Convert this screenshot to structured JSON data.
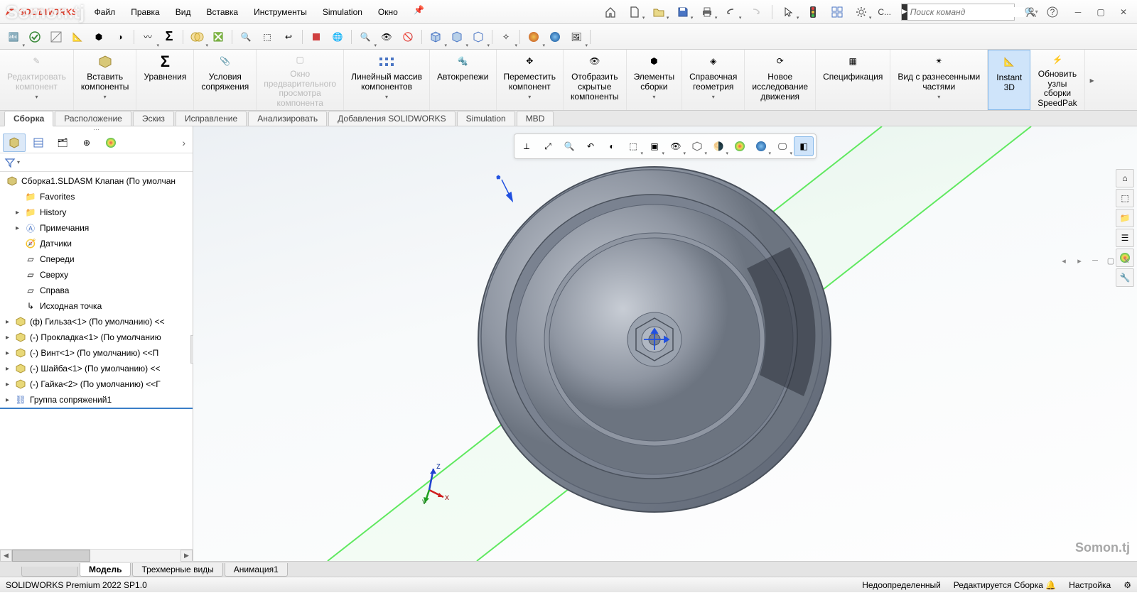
{
  "watermark1": "Somon.tj",
  "watermark2": "Somon.tj",
  "app_logo_text": "SOLIDWORKS",
  "menu": [
    "Файл",
    "Правка",
    "Вид",
    "Вставка",
    "Инструменты",
    "Simulation",
    "Окно"
  ],
  "search_placeholder": "Поиск команд",
  "search_caret_label": "С...",
  "file_tabs": [
    "Сборка",
    "Расположение",
    "Эскиз",
    "Исправление",
    "Анализировать",
    "Добавления SOLIDWORKS",
    "Simulation",
    "MBD"
  ],
  "file_tab_active": 0,
  "ribbon": [
    {
      "label": "Редактировать\nкомпонент",
      "disabled": true,
      "dd": true
    },
    {
      "label": "Вставить\nкомпоненты",
      "dd": true
    },
    {
      "label": "Уравнения"
    },
    {
      "label": "Условия\nсопряжения"
    },
    {
      "label": "Окно\nпредварительного\nпросмотра\nкомпонента",
      "disabled": true
    },
    {
      "label": "Линейный массив\nкомпонентов",
      "dd": true
    },
    {
      "label": "Автокрепежи"
    },
    {
      "label": "Переместить\nкомпонент",
      "dd": true
    },
    {
      "label": "Отобразить\nскрытые\nкомпоненты"
    },
    {
      "label": "Элементы\nсборки",
      "dd": true
    },
    {
      "label": "Справочная\nгеометрия",
      "dd": true
    },
    {
      "label": "Новое\nисследование\nдвижения"
    },
    {
      "label": "Спецификация"
    },
    {
      "label": "Вид с разнесенными\nчастями",
      "dd": true
    },
    {
      "label": "Instant\n3D",
      "active": true
    },
    {
      "label": "Обновить\nузлы\nсборки\nSpeedPak"
    }
  ],
  "tree_root": "Сборка1.SLDASM Клапан (По умолчан",
  "tree": [
    {
      "label": "Favorites",
      "icon": "folder",
      "indent": 1
    },
    {
      "label": "History",
      "icon": "folder",
      "indent": 1,
      "exp": "▸"
    },
    {
      "label": "Примечания",
      "icon": "note",
      "indent": 1,
      "exp": "▸"
    },
    {
      "label": "Датчики",
      "icon": "sensor",
      "indent": 1
    },
    {
      "label": "Спереди",
      "icon": "plane",
      "indent": 1
    },
    {
      "label": "Сверху",
      "icon": "plane",
      "indent": 1
    },
    {
      "label": "Справа",
      "icon": "plane",
      "indent": 1
    },
    {
      "label": "Исходная точка",
      "icon": "origin",
      "indent": 1
    },
    {
      "label": "(ф) Гильза<1> (По умолчанию) <<",
      "icon": "part",
      "exp": "▸"
    },
    {
      "label": "(-) Прокладка<1> (По умолчанию",
      "icon": "part",
      "exp": "▸"
    },
    {
      "label": "(-) Винт<1> (По умолчанию) <<П",
      "icon": "part",
      "exp": "▸"
    },
    {
      "label": "(-) Шайба<1> (По умолчанию) <<",
      "icon": "part",
      "exp": "▸"
    },
    {
      "label": "(-) Гайка<2> (По умолчанию) <<Г",
      "icon": "part",
      "exp": "▸"
    },
    {
      "label": "Группа сопряжений1",
      "icon": "mates",
      "exp": "▸",
      "hl": true
    }
  ],
  "bottom_tabs": [
    "Модель",
    "Трехмерные виды",
    "Анимация1"
  ],
  "bottom_tab_active": 0,
  "status_left": "SOLIDWORKS Premium 2022 SP1.0",
  "status_right": [
    "Недоопределенный",
    "Редактируется Сборка",
    "Настройка"
  ],
  "triad_labels": {
    "x": "x",
    "y": "y",
    "z": "z"
  }
}
